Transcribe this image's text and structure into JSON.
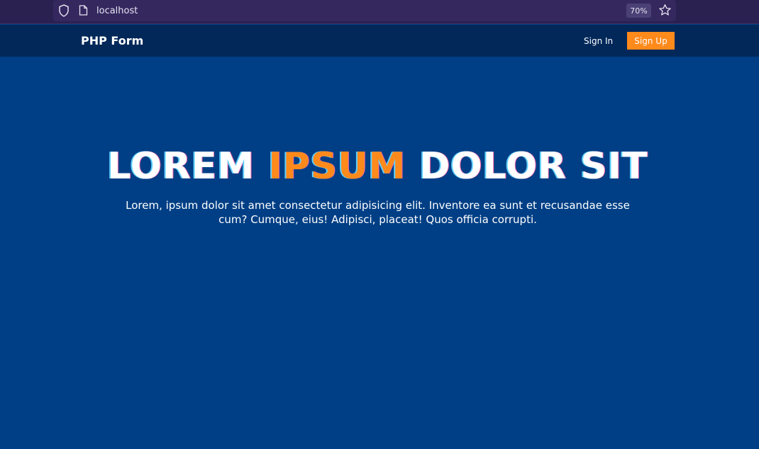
{
  "browser": {
    "url": "localhost",
    "zoom": "70%"
  },
  "navbar": {
    "brand": "PHP Form",
    "signin_label": "Sign In",
    "signup_label": "Sign Up"
  },
  "hero": {
    "title_part1": "LOREM",
    "title_accent": "IPSUM",
    "title_part2": "DOLOR SIT",
    "subtitle": "Lorem, ipsum dolor sit amet consectetur adipisicing elit. Inventore ea sunt et recusandae esse cum? Cumque, eius! Adipisci, placeat! Quos officia corrupti."
  },
  "colors": {
    "accent": "#ff8a1c",
    "navbar_bg": "#02285a",
    "hero_bg": "#003f85",
    "browser_bg": "#2b2150"
  }
}
